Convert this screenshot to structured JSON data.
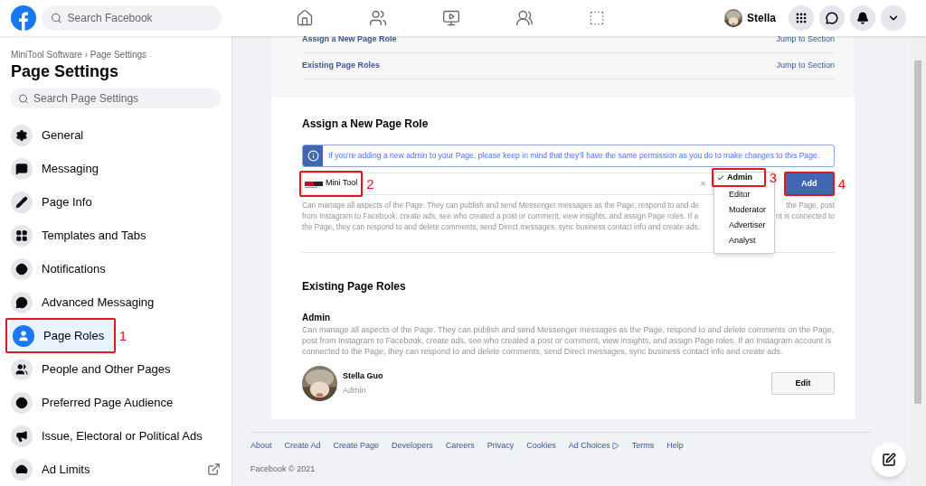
{
  "header": {
    "search_placeholder": "Search Facebook",
    "profile_name": "Stella"
  },
  "sidebar": {
    "breadcrumb": "MiniTool Software › Page Settings",
    "title": "Page Settings",
    "search_placeholder": "Search Page Settings",
    "items": [
      {
        "label": "General",
        "selected": false,
        "external": false
      },
      {
        "label": "Messaging",
        "selected": false,
        "external": false
      },
      {
        "label": "Page Info",
        "selected": false,
        "external": false
      },
      {
        "label": "Templates and Tabs",
        "selected": false,
        "external": false
      },
      {
        "label": "Notifications",
        "selected": false,
        "external": false
      },
      {
        "label": "Advanced Messaging",
        "selected": false,
        "external": false
      },
      {
        "label": "Page Roles",
        "selected": true,
        "external": false,
        "annotation": "1"
      },
      {
        "label": "People and Other Pages",
        "selected": false,
        "external": false
      },
      {
        "label": "Preferred Page Audience",
        "selected": false,
        "external": false
      },
      {
        "label": "Issue, Electoral or Political Ads",
        "selected": false,
        "external": false
      },
      {
        "label": "Ad Limits",
        "selected": false,
        "external": true
      }
    ]
  },
  "jump_links": [
    {
      "label": "Assign a New Page Role",
      "action": "Jump to Section"
    },
    {
      "label": "Existing Page Roles",
      "action": "Jump to Section"
    }
  ],
  "assign": {
    "title": "Assign a New Page Role",
    "info": "If you're adding a new admin to your Page, please keep in mind that they'll have the same permission as you do to make changes to this Page.",
    "page_name": "Mini Tool",
    "page_annotation": "2",
    "clear": "×",
    "description_lines": [
      {
        "left": "Can manage all aspects of the Page. They can publish and send Messenger messages as the Page, respond to and de",
        "right": "the Page, post"
      },
      {
        "left": "from Instagram to Facebook, create ads, see who created a post or comment, view insights, and assign Page roles. If a",
        "right": "nt is connected to"
      },
      {
        "left": "the Page, they can respond to and delete comments, send Direct messages, sync business contact info and create ads."
      }
    ],
    "roles": [
      {
        "label": "Admin",
        "selected": true
      },
      {
        "label": "Editor",
        "selected": false
      },
      {
        "label": "Moderator",
        "selected": false
      },
      {
        "label": "Advertiser",
        "selected": false
      },
      {
        "label": "Analyst",
        "selected": false
      }
    ],
    "roles_annotation": "3",
    "add_button": "Add",
    "add_annotation": "4"
  },
  "existing": {
    "title": "Existing Page Roles",
    "role": "Admin",
    "description": "Can manage all aspects of the Page. They can publish and send Messenger messages as the Page, respond to and delete comments on the Page, post from Instagram to Facebook, create ads, see who created a post or comment, view insights, and assign Page roles. If an Instagram account is connected to the Page, they can respond to and delete comments, send Direct messages, sync business contact info and create ads.",
    "people": [
      {
        "name": "Stella Guo",
        "role": "Admin",
        "action": "Edit"
      }
    ]
  },
  "footer": {
    "links": [
      "About",
      "Create Ad",
      "Create Page",
      "Developers",
      "Careers",
      "Privacy",
      "Cookies",
      "Ad Choices",
      "Terms",
      "Help"
    ],
    "copyright": "Facebook © 2021"
  }
}
